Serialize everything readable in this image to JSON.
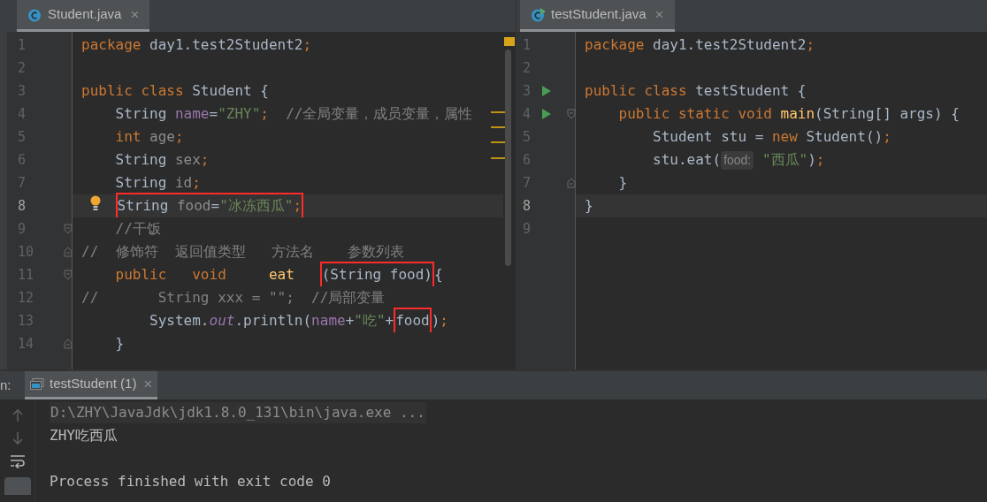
{
  "editors": [
    {
      "tab": {
        "label": "Student.java",
        "selected": true,
        "close": "×"
      },
      "lines": [
        {
          "n": "1",
          "current": false,
          "bulb": false,
          "fold_start": false,
          "fold_end": false,
          "tokens": [
            {
              "kind": "keyword",
              "t": "package"
            },
            {
              "kind": "plain",
              "t": " day1.test2Student2"
            },
            {
              "kind": "keyword",
              "t": ";"
            }
          ]
        },
        {
          "n": "2",
          "current": false,
          "bulb": false,
          "fold_start": false,
          "fold_end": false
        },
        {
          "n": "3",
          "current": false,
          "bulb": false,
          "fold_start": false,
          "fold_end": false,
          "tokens": [
            {
              "kind": "keyword",
              "t": "public class "
            },
            {
              "kind": "plain",
              "t": "Student {"
            }
          ]
        },
        {
          "n": "4",
          "current": false,
          "bulb": false,
          "fold_start": false,
          "fold_end": false,
          "tokens": [
            {
              "kind": "plain",
              "t": "    String "
            },
            {
              "kind": "field",
              "t": "name"
            },
            {
              "kind": "plain",
              "t": "="
            },
            {
              "kind": "string",
              "t": "\"ZHY\""
            },
            {
              "kind": "keyword",
              "t": ";"
            },
            {
              "kind": "comment",
              "t": "  //全局变量，成员变量，属性"
            }
          ]
        },
        {
          "n": "5",
          "current": false,
          "bulb": false,
          "fold_start": false,
          "fold_end": false,
          "tokens": [
            {
              "kind": "keyword",
              "t": "    int"
            },
            {
              "kind": "unused",
              "t": " age"
            },
            {
              "kind": "keyword",
              "t": ";"
            }
          ]
        },
        {
          "n": "6",
          "current": false,
          "bulb": false,
          "fold_start": false,
          "fold_end": false,
          "tokens": [
            {
              "kind": "plain",
              "t": "    String"
            },
            {
              "kind": "unused",
              "t": " sex"
            },
            {
              "kind": "keyword",
              "t": ";"
            }
          ]
        },
        {
          "n": "7",
          "current": false,
          "bulb": false,
          "fold_start": false,
          "fold_end": false,
          "tokens": [
            {
              "kind": "plain",
              "t": "    String"
            },
            {
              "kind": "unused",
              "t": " id"
            },
            {
              "kind": "keyword",
              "t": ";"
            }
          ]
        },
        {
          "n": "8",
          "current": true,
          "bulb": true,
          "fold_start": false,
          "fold_end": false,
          "tokens": [
            {
              "kind": "boxed",
              "tokens": [
                {
                  "kind": "plain",
                  "t": "    String "
                },
                {
                  "kind": "unused",
                  "t": "food"
                },
                {
                  "kind": "plain",
                  "t": "="
                },
                {
                  "kind": "string",
                  "t": "\"冰冻西瓜\""
                },
                {
                  "kind": "keyword",
                  "t": ";"
                }
              ]
            }
          ]
        },
        {
          "n": "9",
          "current": false,
          "bulb": false,
          "fold_start": true,
          "fold_end": false,
          "tokens": [
            {
              "kind": "comment",
              "t": "    //干饭"
            }
          ]
        },
        {
          "n": "10",
          "current": false,
          "bulb": false,
          "fold_start": false,
          "fold_end": true,
          "tokens": [
            {
              "kind": "comment",
              "t": "//  修饰符  返回值类型   方法名    参数列表"
            }
          ]
        },
        {
          "n": "11",
          "current": false,
          "bulb": false,
          "fold_start": true,
          "fold_end": false,
          "tokens": [
            {
              "kind": "keyword",
              "t": "    public"
            },
            {
              "kind": "keyword",
              "t": "   void"
            },
            {
              "kind": "method",
              "t": "     eat   "
            },
            {
              "kind": "boxed",
              "tokens": [
                {
                  "kind": "plain",
                  "t": "(String food)"
                }
              ]
            },
            {
              "kind": "plain",
              "t": "{"
            }
          ]
        },
        {
          "n": "12",
          "current": false,
          "bulb": false,
          "fold_start": false,
          "fold_end": false,
          "tokens": [
            {
              "kind": "comment",
              "t": "//       String xxx = \"\";  //局部变量"
            }
          ]
        },
        {
          "n": "13",
          "current": false,
          "bulb": false,
          "fold_start": false,
          "fold_end": false,
          "tokens": [
            {
              "kind": "plain",
              "t": "        System."
            },
            {
              "kind": "static",
              "t": "out"
            },
            {
              "kind": "plain",
              "t": ".println("
            },
            {
              "kind": "field",
              "t": "name"
            },
            {
              "kind": "plain",
              "t": "+"
            },
            {
              "kind": "string",
              "t": "\"吃\""
            },
            {
              "kind": "plain",
              "t": "+"
            },
            {
              "kind": "boxed",
              "tokens": [
                {
                  "kind": "plain",
                  "t": "food"
                }
              ]
            },
            {
              "kind": "plain",
              "t": ")"
            },
            {
              "kind": "keyword",
              "t": ";"
            }
          ]
        },
        {
          "n": "14",
          "current": false,
          "bulb": false,
          "fold_start": false,
          "fold_end": true,
          "tokens": [
            {
              "kind": "plain",
              "t": "    }"
            }
          ]
        }
      ]
    },
    {
      "tab": {
        "label": "testStudent.java",
        "selected": true,
        "close": "×"
      },
      "lines": [
        {
          "n": "1",
          "current": false,
          "run": false,
          "fold_start": false,
          "fold_end": false,
          "tokens": [
            {
              "kind": "keyword",
              "t": "package"
            },
            {
              "kind": "plain",
              "t": " day1.test2Student2"
            },
            {
              "kind": "keyword",
              "t": ";"
            }
          ]
        },
        {
          "n": "2",
          "current": false,
          "run": false,
          "fold_start": false,
          "fold_end": false
        },
        {
          "n": "3",
          "current": false,
          "run": true,
          "fold_start": false,
          "fold_end": false,
          "tokens": [
            {
              "kind": "keyword",
              "t": "public class "
            },
            {
              "kind": "plain",
              "t": "testStudent {"
            }
          ]
        },
        {
          "n": "4",
          "current": false,
          "run": true,
          "fold_start": true,
          "fold_end": false,
          "tokens": [
            {
              "kind": "keyword",
              "t": "    public static void "
            },
            {
              "kind": "method",
              "t": "main"
            },
            {
              "kind": "plain",
              "t": "(String[] args) {"
            }
          ]
        },
        {
          "n": "5",
          "current": false,
          "run": false,
          "fold_start": false,
          "fold_end": false,
          "tokens": [
            {
              "kind": "plain",
              "t": "        Student stu = "
            },
            {
              "kind": "keyword",
              "t": "new "
            },
            {
              "kind": "plain",
              "t": "Student()"
            },
            {
              "kind": "keyword",
              "t": ";"
            }
          ]
        },
        {
          "n": "6",
          "current": false,
          "run": false,
          "fold_start": false,
          "fold_end": false,
          "tokens": [
            {
              "kind": "plain",
              "t": "        stu.eat("
            },
            {
              "kind": "hint",
              "t": "food:"
            },
            {
              "kind": "string",
              "t": " \"西瓜\""
            },
            {
              "kind": "plain",
              "t": ")"
            },
            {
              "kind": "keyword",
              "t": ";"
            }
          ]
        },
        {
          "n": "7",
          "current": false,
          "run": false,
          "fold_start": false,
          "fold_end": true,
          "tokens": [
            {
              "kind": "plain",
              "t": "    }"
            }
          ]
        },
        {
          "n": "8",
          "current": true,
          "run": false,
          "fold_start": false,
          "fold_end": false,
          "tokens": [
            {
              "kind": "plain",
              "t": "}"
            }
          ]
        },
        {
          "n": "9",
          "current": false,
          "run": false,
          "fold_start": false,
          "fold_end": false
        }
      ]
    }
  ],
  "run_panel": {
    "label": "n:",
    "tab": {
      "label": "testStudent (1)",
      "selected": true,
      "close": "×"
    },
    "console": [
      {
        "kind": "command",
        "text": "D:\\ZHY\\JavaJdk\\jdk1.8.0_131\\bin\\java.exe ..."
      },
      {
        "kind": "output",
        "text": "ZHY吃西瓜"
      },
      {
        "kind": "status",
        "text": "Process finished with exit code 0"
      }
    ]
  }
}
